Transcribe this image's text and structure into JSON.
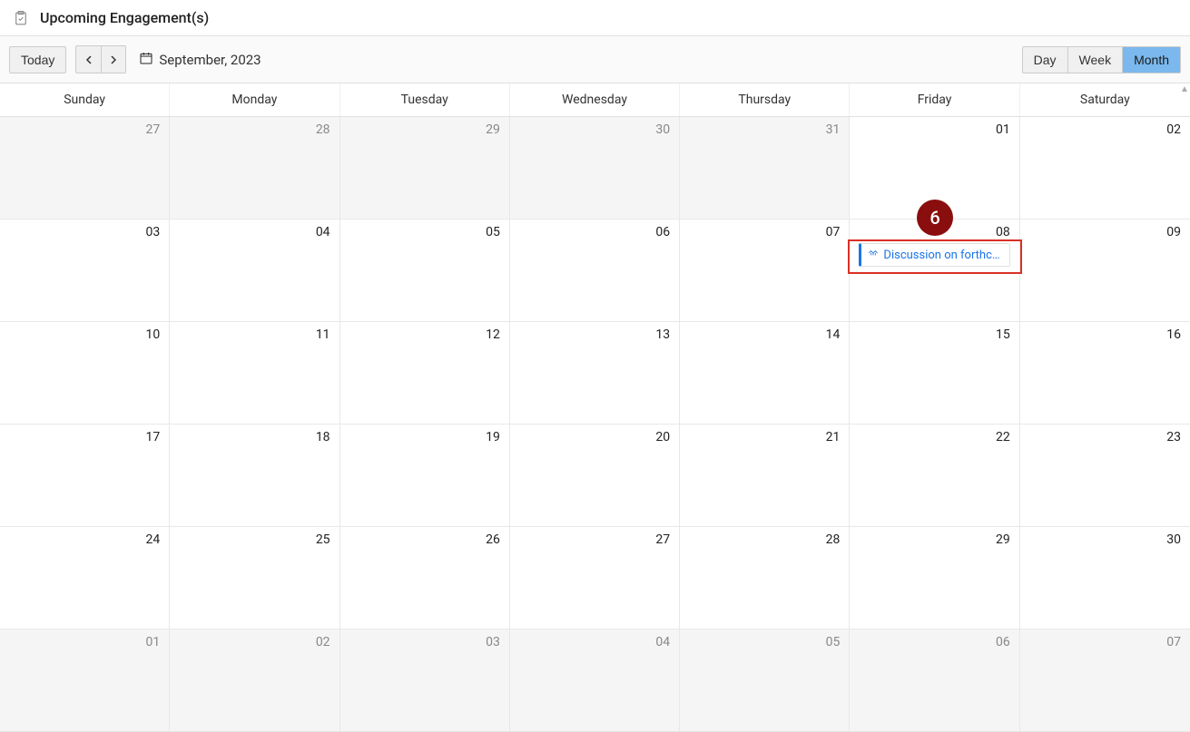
{
  "header": {
    "title": "Upcoming Engagement(s)"
  },
  "toolbar": {
    "today_label": "Today",
    "date_label": "September, 2023",
    "views": {
      "day": "Day",
      "week": "Week",
      "month": "Month",
      "active": "month"
    }
  },
  "day_headers": [
    "Sunday",
    "Monday",
    "Tuesday",
    "Wednesday",
    "Thursday",
    "Friday",
    "Saturday"
  ],
  "weeks": [
    {
      "days": [
        {
          "n": "27",
          "other": true
        },
        {
          "n": "28",
          "other": true
        },
        {
          "n": "29",
          "other": true
        },
        {
          "n": "30",
          "other": true
        },
        {
          "n": "31",
          "other": true
        },
        {
          "n": "01",
          "other": false
        },
        {
          "n": "02",
          "other": false
        }
      ]
    },
    {
      "days": [
        {
          "n": "03",
          "other": false
        },
        {
          "n": "04",
          "other": false
        },
        {
          "n": "05",
          "other": false
        },
        {
          "n": "06",
          "other": false
        },
        {
          "n": "07",
          "other": false
        },
        {
          "n": "08",
          "other": false,
          "event": {
            "text": "Discussion on forthc…"
          }
        },
        {
          "n": "09",
          "other": false
        }
      ]
    },
    {
      "days": [
        {
          "n": "10",
          "other": false
        },
        {
          "n": "11",
          "other": false
        },
        {
          "n": "12",
          "other": false
        },
        {
          "n": "13",
          "other": false
        },
        {
          "n": "14",
          "other": false
        },
        {
          "n": "15",
          "other": false
        },
        {
          "n": "16",
          "other": false
        }
      ]
    },
    {
      "days": [
        {
          "n": "17",
          "other": false
        },
        {
          "n": "18",
          "other": false
        },
        {
          "n": "19",
          "other": false
        },
        {
          "n": "20",
          "other": false
        },
        {
          "n": "21",
          "other": false
        },
        {
          "n": "22",
          "other": false
        },
        {
          "n": "23",
          "other": false
        }
      ]
    },
    {
      "days": [
        {
          "n": "24",
          "other": false
        },
        {
          "n": "25",
          "other": false
        },
        {
          "n": "26",
          "other": false
        },
        {
          "n": "27",
          "other": false
        },
        {
          "n": "28",
          "other": false
        },
        {
          "n": "29",
          "other": false
        },
        {
          "n": "30",
          "other": false
        }
      ]
    },
    {
      "days": [
        {
          "n": "01",
          "other": true
        },
        {
          "n": "02",
          "other": true
        },
        {
          "n": "03",
          "other": true
        },
        {
          "n": "04",
          "other": true
        },
        {
          "n": "05",
          "other": true
        },
        {
          "n": "06",
          "other": true
        },
        {
          "n": "07",
          "other": true
        }
      ]
    }
  ],
  "annotation": {
    "badge_text": "6",
    "event_text": "Discussion on forthc…"
  }
}
